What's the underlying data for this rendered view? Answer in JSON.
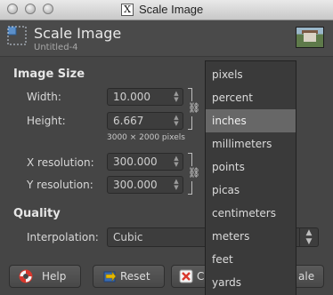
{
  "window": {
    "title": "Scale Image",
    "title_icon": "X"
  },
  "header": {
    "title": "Scale Image",
    "subtitle": "Untitled-4"
  },
  "image_size": {
    "section_title": "Image Size",
    "width_label": "Width:",
    "width_value": "10.000",
    "height_label": "Height:",
    "height_value": "6.667",
    "pixels_note": "3000 × 2000 pixels",
    "xres_label": "X resolution:",
    "xres_value": "300.000",
    "yres_label": "Y resolution:",
    "yres_value": "300.000"
  },
  "quality": {
    "section_title": "Quality",
    "interp_label": "Interpolation:",
    "interp_value": "Cubic"
  },
  "buttons": {
    "help": "Help",
    "reset": "Reset",
    "cancel": "C",
    "scale": "ale"
  },
  "unit_menu": {
    "items": [
      "pixels",
      "percent",
      "inches",
      "millimeters",
      "points",
      "picas",
      "centimeters",
      "meters",
      "feet",
      "yards"
    ],
    "selected": "inches"
  },
  "colors": {
    "background": "#454545",
    "selection": "#676767",
    "help_icon": "#d9372c",
    "reset_icon": "#e4b800",
    "cancel_icon": "#d9372c"
  }
}
